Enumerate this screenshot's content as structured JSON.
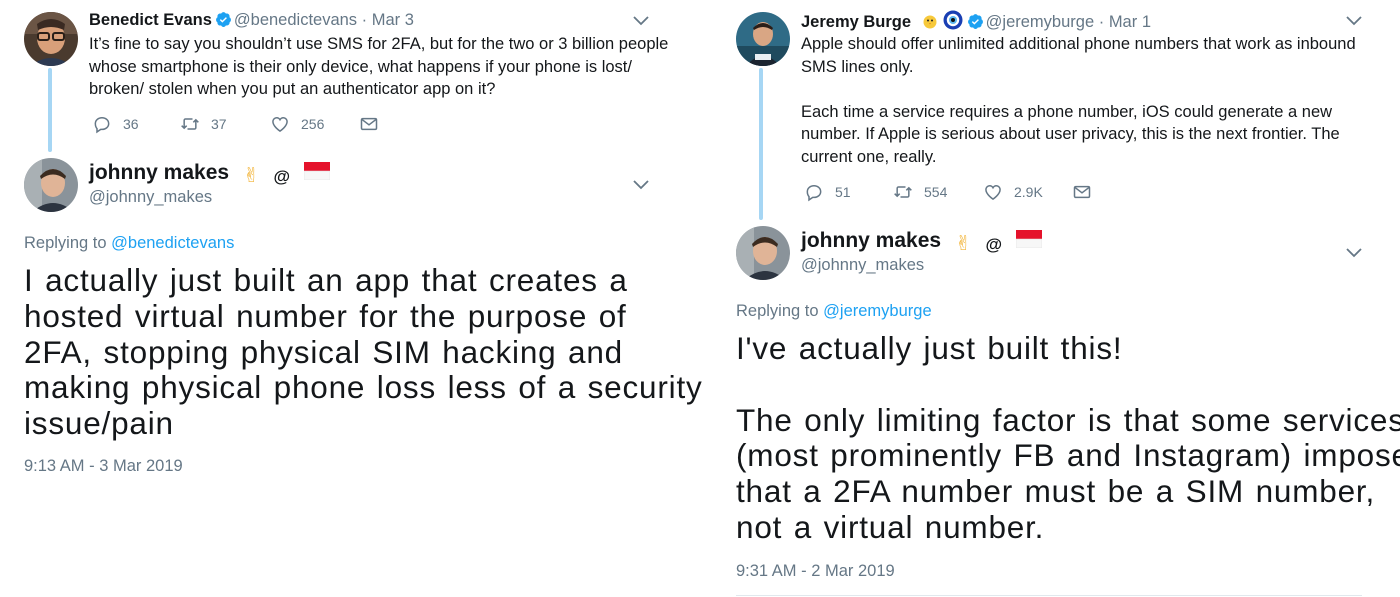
{
  "left": {
    "parent_tweet": {
      "author_name": "Benedict Evans",
      "handle": "@benedictevans",
      "separator": "·",
      "date": "Mar 3",
      "text_lines": [
        "It’s fine to say you shouldn’t use SMS for 2FA, but for the two or 3 billion people",
        "whose smartphone is their only device, what happens if your phone is lost/",
        "broken/ stolen when you put an authenticator app on it?"
      ],
      "replies": "36",
      "retweets": "37",
      "likes": "256"
    },
    "reply_tweet": {
      "author_name": "johnny makes",
      "name_emojis": "✌️ @",
      "handle": "@johnny_makes",
      "replying_prefix": "Replying to",
      "replying_to": "@benedictevans",
      "text_lines": [
        "I actually just built an app that creates a",
        "hosted virtual number for the purpose of",
        "2FA, stopping physical SIM hacking and",
        "making physical phone loss less of a security",
        "issue/pain"
      ],
      "timestamp": "9:13 AM - 3 Mar 2019"
    }
  },
  "right": {
    "parent_tweet": {
      "author_name": "Jeremy Burge",
      "handle": "@jeremyburge",
      "separator": "·",
      "date": "Mar 1",
      "text_lines": [
        "Apple should offer unlimited additional phone numbers that work as inbound",
        "SMS lines only.",
        "",
        "Each time a service requires a phone number, iOS could generate a new",
        "number. If Apple is serious about user privacy, this is the next frontier. The",
        "current one, really."
      ],
      "replies": "51",
      "retweets": "554",
      "likes": "2.9K"
    },
    "reply_tweet": {
      "author_name": "johnny makes",
      "name_emojis": "✌️ @",
      "handle": "@johnny_makes",
      "replying_prefix": "Replying to",
      "replying_to": "@jeremyburge",
      "text_lines": [
        "I've actually just built this!",
        "",
        "The only limiting factor is that some services",
        "(most prominently FB and Instagram) impose",
        "that a 2FA number must be a SIM number,",
        "not a virtual number."
      ],
      "timestamp": "9:31 AM - 2 Mar 2019"
    }
  },
  "colors": {
    "text": "#14171a",
    "secondary": "#657786",
    "link": "#1da1f2",
    "thread_line": "#a6d6f4",
    "verified": "#1da1f2"
  }
}
